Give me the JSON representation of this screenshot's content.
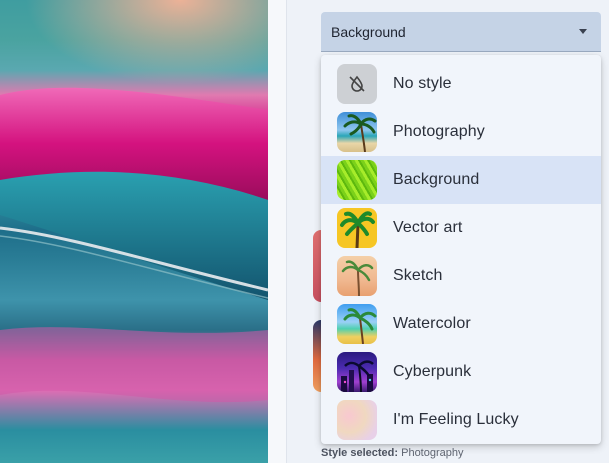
{
  "style_dropdown": {
    "selected_value": "Background",
    "options": [
      {
        "label": "No style",
        "icon": "no-style-icon"
      },
      {
        "label": "Photography",
        "icon": "photography-thumbnail"
      },
      {
        "label": "Background",
        "icon": "background-thumbnail"
      },
      {
        "label": "Vector art",
        "icon": "vector-art-thumbnail"
      },
      {
        "label": "Sketch",
        "icon": "sketch-thumbnail"
      },
      {
        "label": "Watercolor",
        "icon": "watercolor-thumbnail"
      },
      {
        "label": "Cyberpunk",
        "icon": "cyberpunk-thumbnail"
      },
      {
        "label": "I'm Feeling Lucky",
        "icon": "feeling-lucky-thumbnail"
      }
    ],
    "highlighted_index": 2
  },
  "footer": {
    "label": "Style selected:",
    "value": "Photography"
  },
  "colors": {
    "dropdown_field": "#c5d3e6",
    "menu_background": "#f1f5fb",
    "highlight": "#d8e3f6"
  }
}
